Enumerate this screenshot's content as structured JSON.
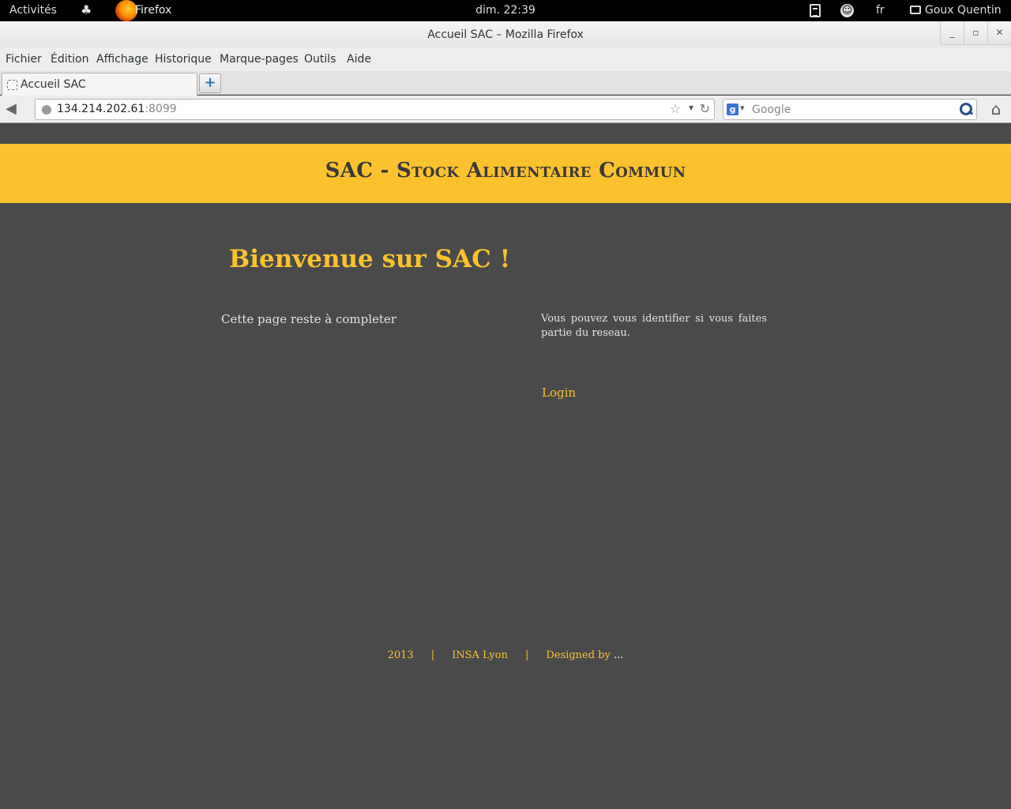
{
  "topbar": {
    "activities": "Activités",
    "app_name": "Firefox",
    "clock": "dim. 22:39",
    "lang": "fr",
    "user": "Goux Quentin"
  },
  "window": {
    "title": "Accueil SAC – Mozilla Firefox"
  },
  "menu": [
    "Fichier",
    "Édition",
    "Affichage",
    "Historique",
    "Marque-pages",
    "Outils",
    "Aide"
  ],
  "tabs": [
    {
      "label": "Accueil SAC"
    }
  ],
  "nav": {
    "url_host": "134.214.202.61",
    "url_port": ":8099",
    "search_placeholder": "Google",
    "search_engine_letter": "g"
  },
  "page": {
    "banner_title": "SAC - Stock Alimentaire Commun",
    "welcome": "Bienvenue sur SAC !",
    "left_note": "Cette page reste à completer",
    "right_note": "Vous pouvez vous identifier si vous faites partie du reseau.",
    "login": "Login",
    "footer": {
      "year": "2013",
      "sep": "|",
      "org": "INSA Lyon",
      "designed_by": "Designed by ",
      "designer": "..."
    }
  },
  "colors": {
    "accent": "#fbc22f",
    "page_bg": "#4a4a4a",
    "text_light": "#e4e4e4"
  }
}
